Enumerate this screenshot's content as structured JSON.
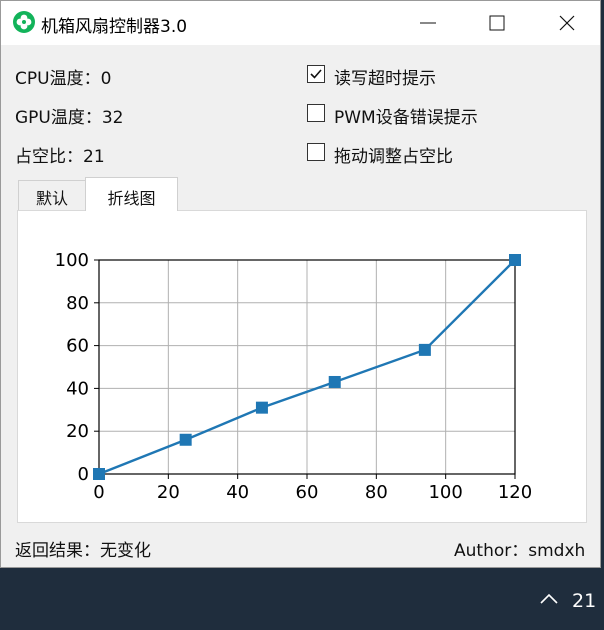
{
  "window": {
    "title": "机箱风扇控制器3.0"
  },
  "readouts": {
    "cpu_temp": "CPU温度：0",
    "gpu_temp": "GPU温度：32",
    "duty_cycle": "占空比：21"
  },
  "options": [
    {
      "label": "读写超时提示",
      "checked": true
    },
    {
      "label": "PWM设备错误提示",
      "checked": false
    },
    {
      "label": "拖动调整占空比",
      "checked": false
    }
  ],
  "tabs": [
    {
      "label": "默认",
      "active": false
    },
    {
      "label": "折线图",
      "active": true
    }
  ],
  "status": {
    "result": "返回结果：无变化",
    "author": "Author：smdxh"
  },
  "taskbar": {
    "clock_partial": "21"
  },
  "chart_data": {
    "type": "line",
    "x": [
      0,
      25,
      47,
      68,
      94,
      120
    ],
    "series": [
      {
        "values": [
          0,
          16,
          31,
          43,
          58,
          100
        ],
        "color": "#1f77b4"
      }
    ],
    "xlim": [
      0,
      120
    ],
    "ylim": [
      0,
      100
    ],
    "xticks": [
      "0",
      "20",
      "40",
      "60",
      "80",
      "100",
      "120"
    ],
    "yticks": [
      "0",
      "20",
      "40",
      "60",
      "80",
      "100"
    ],
    "grid": true
  }
}
